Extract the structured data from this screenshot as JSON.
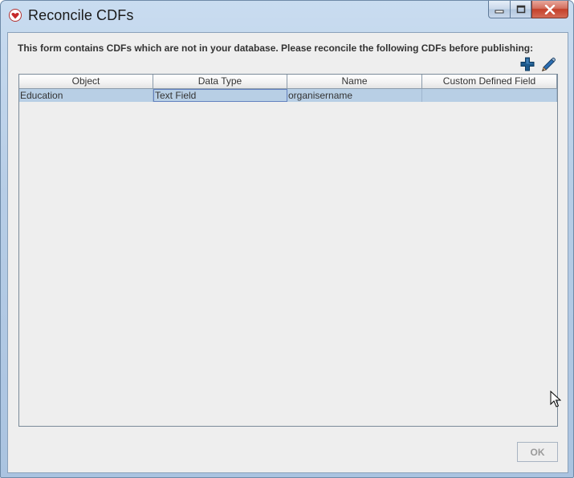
{
  "window": {
    "title": "Reconcile CDFs",
    "icon": "red-heart-app-icon",
    "controls": [
      "minimize-icon",
      "maximize-icon",
      "close-icon"
    ]
  },
  "message": "This form contains CDFs which are not in your database. Please reconcile the following CDFs before publishing:",
  "toolbar": {
    "add_icon": "plus-icon",
    "edit_icon": "pencil-icon"
  },
  "table": {
    "columns": [
      "Object",
      "Data Type",
      "Name",
      "Custom Defined Field"
    ],
    "rows": [
      [
        "Education",
        "Text Field",
        "organisername",
        ""
      ]
    ],
    "selected_row_color": "#b8cfe5"
  },
  "footer": {
    "ok_label": "OK"
  }
}
